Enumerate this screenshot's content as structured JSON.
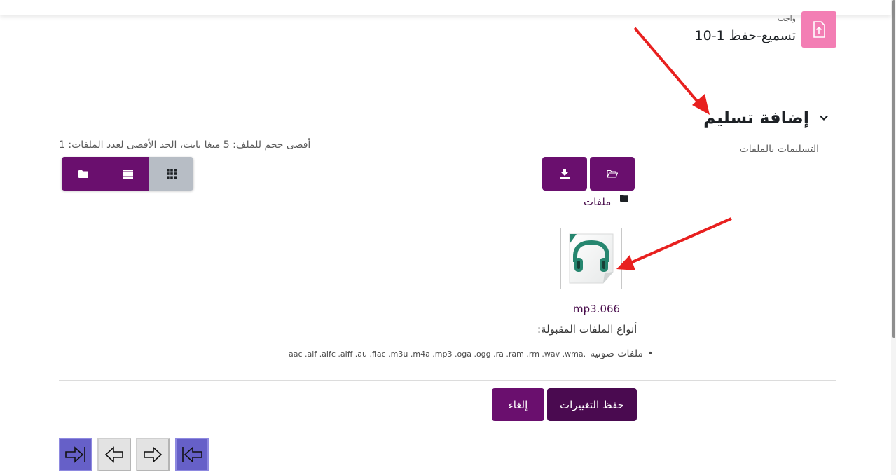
{
  "header": {
    "activity_type": "واجب",
    "activity_title": "تسميع-حفظ 1-10",
    "icon": "file-upload-icon",
    "icon_bg": "#f37eb4"
  },
  "section": {
    "title": "إضافة تسليم",
    "field_label": "التسليمات بالملفات"
  },
  "filepicker": {
    "limits": "أقصى حجم للملف: 5  ميغا بايت، الحد الأقصى لعدد الملفات: 1",
    "path_label": "ملفات",
    "file_name": "mp3.066",
    "file_icon": "headphones-audio-file-icon",
    "buttons": {
      "add_file_icon": "folder-open-icon",
      "download_icon": "download-icon",
      "view_icons": "grid-icon",
      "view_list": "list-icon",
      "view_tree": "folder-icon"
    }
  },
  "accepted": {
    "label": "أنواع الملفات المقبولة:",
    "group_name": "ملفات صوتية",
    "extensions": "aac .aif .aifc .aiff .au .flac .m3u .m4a .mp3 .oga .ogg .ra .ram .rm .wav .wma."
  },
  "actions": {
    "save_label": "حفظ التغييرات",
    "cancel_label": "إلغاء"
  },
  "colors": {
    "primary": "#6a0f6e",
    "primary_dark": "#4a0a50",
    "annotation_arrow": "#e8201f",
    "nav_blue": "#6660c8"
  },
  "nav_buttons": [
    "last-page-icon",
    "back-arrow-icon",
    "forward-arrow-icon",
    "first-page-icon"
  ]
}
